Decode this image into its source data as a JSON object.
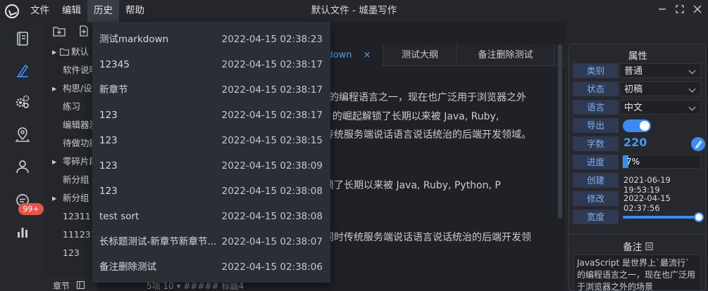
{
  "app": {
    "window_title": "默认文件 - 城墨写作",
    "menu": [
      "文件",
      "编辑",
      "历史",
      "帮助"
    ],
    "active_menu": "历史",
    "badge_count": "99+",
    "accent_color": "#3a8af0"
  },
  "history": [
    {
      "name": "测试markdown",
      "time": "2022-04-15 02:38:23"
    },
    {
      "name": "12345",
      "time": "2022-04-15 02:38:17"
    },
    {
      "name": "新章节",
      "time": "2022-04-15 02:38:17"
    },
    {
      "name": "123",
      "time": "2022-04-15 02:38:17"
    },
    {
      "name": "123",
      "time": "2022-04-15 02:38:15"
    },
    {
      "name": "123",
      "time": "2022-04-15 02:38:09"
    },
    {
      "name": "123",
      "time": "2022-04-15 02:38:08"
    },
    {
      "name": "test sort",
      "time": "2022-04-15 02:38:08"
    },
    {
      "name": "长标题测试-新章节新章节...",
      "time": "2022-04-15 02:38:07"
    },
    {
      "name": "备注删除测试",
      "time": "2022-04-15 02:38:06"
    }
  ],
  "tree": {
    "items": [
      {
        "label": "默认",
        "arrow": "▸",
        "folder": true
      },
      {
        "label": "软件说明",
        "arrow": "",
        "folder": false
      },
      {
        "label": "构思/设定",
        "arrow": "▸",
        "folder": false
      },
      {
        "label": "练习",
        "arrow": "",
        "folder": false
      },
      {
        "label": "编辑器测",
        "arrow": "",
        "folder": false
      },
      {
        "label": "待做功能",
        "arrow": "",
        "folder": false
      },
      {
        "label": "零碎片段",
        "arrow": "▸",
        "folder": false
      },
      {
        "label": "新分组",
        "arrow": "",
        "folder": false
      },
      {
        "label": "新分组",
        "arrow": "▸",
        "folder": false
      },
      {
        "label": "12311",
        "arrow": "",
        "folder": false
      },
      {
        "label": "111231",
        "arrow": "",
        "folder": false
      },
      {
        "label": "123",
        "arrow": "",
        "folder": false
      }
    ],
    "bottom_label": "章节"
  },
  "tabs": [
    {
      "label": "down",
      "active": true,
      "closable": "×"
    },
    {
      "label": "测试大纲",
      "active": false
    },
    {
      "label": "备注删除测试",
      "active": false
    }
  ],
  "editor": {
    "lines": [
      "`的编程语言之一，现在也广泛用于浏览器之外",
      "s 的崛起解锁了长期以来被 Java, Ruby,",
      "传统服务端说话语言说话统治的后端开发领域。",
      "锁了长期以来被 Java, Ruby, Python, P",
      "同时传统服务端说话语言说话统治的后端开发领"
    ],
    "status": "5项    10 ▾  ##### 标题4"
  },
  "properties": {
    "title": "属性",
    "category_label": "类别",
    "category_value": "普通",
    "status_label": "状态",
    "status_value": "初稿",
    "language_label": "语言",
    "language_value": "中文",
    "export_label": "导出",
    "export_on": true,
    "word_label": "字数",
    "word_count": "220",
    "progress_label": "进度",
    "progress_value": "7%",
    "progress_fraction": 0.07,
    "created_label": "创建",
    "created_value": "2021-06-19 19:53:19",
    "modified_label": "修改",
    "modified_value": "2022-04-15 02:37:56",
    "width_label": "宽度",
    "width_fraction": 1.0
  },
  "notes": {
    "title": "备注",
    "text": "JavaScript 是世界上`最流行`的编程语言之一，现在也广泛用于浏览器之外的场景"
  }
}
